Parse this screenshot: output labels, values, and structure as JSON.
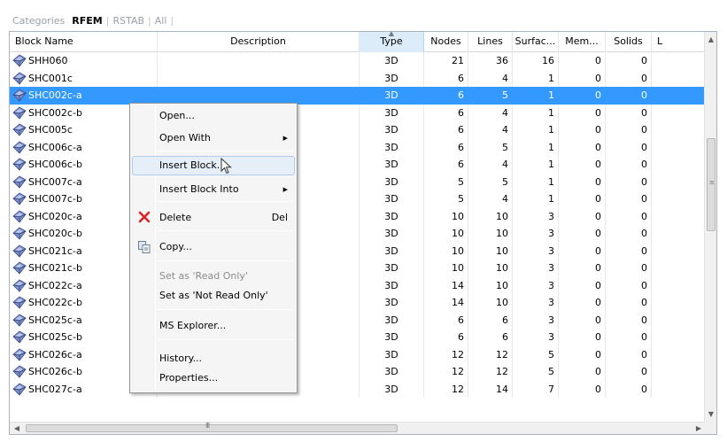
{
  "tabs": {
    "categories": "Categories",
    "rfem": "RFEM",
    "rstab": "RSTAB",
    "all": "All"
  },
  "columns": {
    "block_name": "Block Name",
    "description": "Description",
    "type": "Type",
    "nodes": "Nodes",
    "lines": "Lines",
    "surfaces": "Surfac...",
    "members": "Mem...",
    "solids": "Solids",
    "l": "L"
  },
  "rows": [
    {
      "name": "SHH060",
      "description": "",
      "type": "3D",
      "nodes": "21",
      "lines": "36",
      "surfaces": "16",
      "members": "0",
      "solids": "0"
    },
    {
      "name": "SHC001c",
      "description": "",
      "type": "3D",
      "nodes": "6",
      "lines": "4",
      "surfaces": "1",
      "members": "0",
      "solids": "0"
    },
    {
      "name": "SHC002c-a",
      "description": "",
      "type": "3D",
      "nodes": "6",
      "lines": "5",
      "surfaces": "1",
      "members": "0",
      "solids": "0"
    },
    {
      "name": "SHC002c-b",
      "description": "",
      "type": "3D",
      "nodes": "6",
      "lines": "4",
      "surfaces": "1",
      "members": "0",
      "solids": "0"
    },
    {
      "name": "SHC005c",
      "description": "",
      "type": "3D",
      "nodes": "6",
      "lines": "4",
      "surfaces": "1",
      "members": "0",
      "solids": "0"
    },
    {
      "name": "SHC006c-a",
      "description": "",
      "type": "3D",
      "nodes": "6",
      "lines": "5",
      "surfaces": "1",
      "members": "0",
      "solids": "0"
    },
    {
      "name": "SHC006c-b",
      "description": "",
      "type": "3D",
      "nodes": "6",
      "lines": "4",
      "surfaces": "1",
      "members": "0",
      "solids": "0"
    },
    {
      "name": "SHC007c-a",
      "description": "",
      "type": "3D",
      "nodes": "5",
      "lines": "5",
      "surfaces": "1",
      "members": "0",
      "solids": "0"
    },
    {
      "name": "SHC007c-b",
      "description": "",
      "type": "3D",
      "nodes": "5",
      "lines": "4",
      "surfaces": "1",
      "members": "0",
      "solids": "0"
    },
    {
      "name": "SHC020c-a",
      "description": "",
      "type": "3D",
      "nodes": "10",
      "lines": "10",
      "surfaces": "3",
      "members": "0",
      "solids": "0"
    },
    {
      "name": "SHC020c-b",
      "description": "",
      "type": "3D",
      "nodes": "10",
      "lines": "10",
      "surfaces": "3",
      "members": "0",
      "solids": "0"
    },
    {
      "name": "SHC021c-a",
      "description": "",
      "type": "3D",
      "nodes": "10",
      "lines": "10",
      "surfaces": "3",
      "members": "0",
      "solids": "0"
    },
    {
      "name": "SHC021c-b",
      "description": "",
      "type": "3D",
      "nodes": "10",
      "lines": "10",
      "surfaces": "3",
      "members": "0",
      "solids": "0"
    },
    {
      "name": "SHC022c-a",
      "description": "",
      "type": "3D",
      "nodes": "14",
      "lines": "10",
      "surfaces": "3",
      "members": "0",
      "solids": "0"
    },
    {
      "name": "SHC022c-b",
      "description": "",
      "type": "3D",
      "nodes": "14",
      "lines": "10",
      "surfaces": "3",
      "members": "0",
      "solids": "0"
    },
    {
      "name": "SHC025c-a",
      "description": "",
      "type": "3D",
      "nodes": "6",
      "lines": "6",
      "surfaces": "3",
      "members": "0",
      "solids": "0"
    },
    {
      "name": "SHC025c-b",
      "description": "",
      "type": "3D",
      "nodes": "6",
      "lines": "6",
      "surfaces": "3",
      "members": "0",
      "solids": "0"
    },
    {
      "name": "SHC026c-a",
      "description": "",
      "type": "3D",
      "nodes": "12",
      "lines": "12",
      "surfaces": "5",
      "members": "0",
      "solids": "0"
    },
    {
      "name": "SHC026c-b",
      "description": "",
      "type": "3D",
      "nodes": "12",
      "lines": "12",
      "surfaces": "5",
      "members": "0",
      "solids": "0"
    },
    {
      "name": "SHC027c-a",
      "description": "",
      "type": "3D",
      "nodes": "12",
      "lines": "14",
      "surfaces": "7",
      "members": "0",
      "solids": "0"
    }
  ],
  "selected_row": 2,
  "context_menu": {
    "open": "Open...",
    "open_with": "Open With",
    "insert_block": "Insert Block...",
    "insert_block_into": "Insert Block Into",
    "delete": "Delete",
    "delete_shortcut": "Del",
    "copy": "Copy...",
    "set_read_only": "Set as 'Read Only'",
    "set_not_read_only": "Set as 'Not Read Only'",
    "ms_explorer": "MS Explorer...",
    "history": "History...",
    "properties": "Properties..."
  },
  "icons": {
    "row": "block-diamond-icon",
    "delete": "red-x-delete-icon",
    "copy": "copy-icon"
  },
  "colors": {
    "selection": "#3399ff",
    "menu_hover": "#e6eef8",
    "sorted_header": "#dcecf8"
  }
}
